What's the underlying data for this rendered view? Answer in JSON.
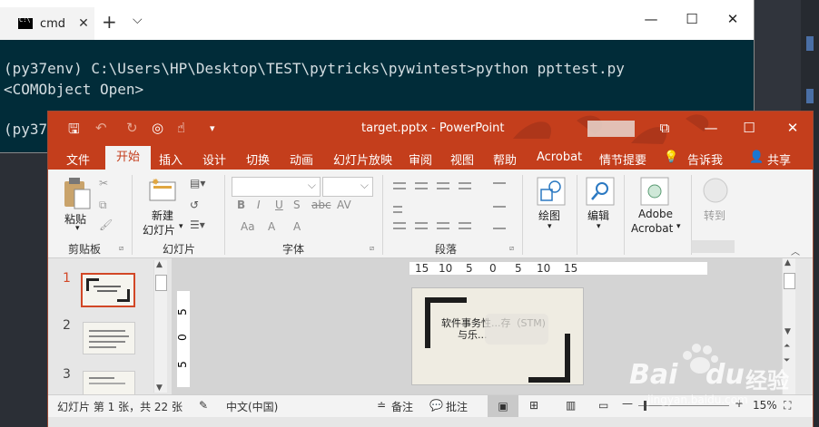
{
  "cmd": {
    "tab_label": "cmd",
    "tab_close": "✕",
    "new_tab": "+",
    "dropdown": "⌵",
    "minimize": "—",
    "maximize": "☐",
    "close": "✕",
    "lines": [
      "(py37env) C:\\Users\\HP\\Desktop\\TEST\\pytricks\\pywintest>python ppttest.py",
      "<COMObject Open>",
      "(py37"
    ]
  },
  "ppt": {
    "doc_title": "target.pptx  -  PowerPoint",
    "window": {
      "restore": "⧉",
      "minimize": "—",
      "maximize": "☐",
      "close": "✕"
    },
    "tabs": [
      "文件",
      "开始",
      "插入",
      "设计",
      "切换",
      "动画",
      "幻灯片放映",
      "审阅",
      "视图",
      "帮助",
      "Acrobat",
      "情节提要"
    ],
    "tell_me": "告诉我",
    "share": "共享",
    "ribbon": {
      "paste": "粘贴",
      "new_slide_1": "新建",
      "new_slide_2": "幻灯片",
      "drawing": "绘图",
      "editing": "编辑",
      "adobe_1": "Adobe",
      "adobe_2": "Acrobat",
      "goto": "转到",
      "groups": {
        "clipboard": "剪贴板",
        "slides": "幻灯片",
        "font": "字体",
        "paragraph": "段落"
      },
      "font_glyphs": [
        "B",
        "I",
        "U",
        "S",
        "abc",
        "AV",
        "Aa",
        "A",
        "A"
      ]
    },
    "thumbnails": [
      "1",
      "2",
      "3"
    ],
    "ruler_h": [
      "15",
      "10",
      "5",
      "0",
      "5",
      "10",
      "15"
    ],
    "ruler_v": [
      "5",
      "0",
      "5"
    ],
    "slide_text": {
      "line1": "软件事务性...存（STM)",
      "line2": "与乐..."
    },
    "status": {
      "slide_info": "幻灯片 第 1 张，共 22 张",
      "language": "中文(中国)",
      "notes": "备注",
      "comments": "批注",
      "zoom": "15%"
    }
  },
  "watermark": {
    "brand": "Bai",
    "brand2": "du",
    "suffix": "经验",
    "url": "jingyan.baidu.com"
  }
}
